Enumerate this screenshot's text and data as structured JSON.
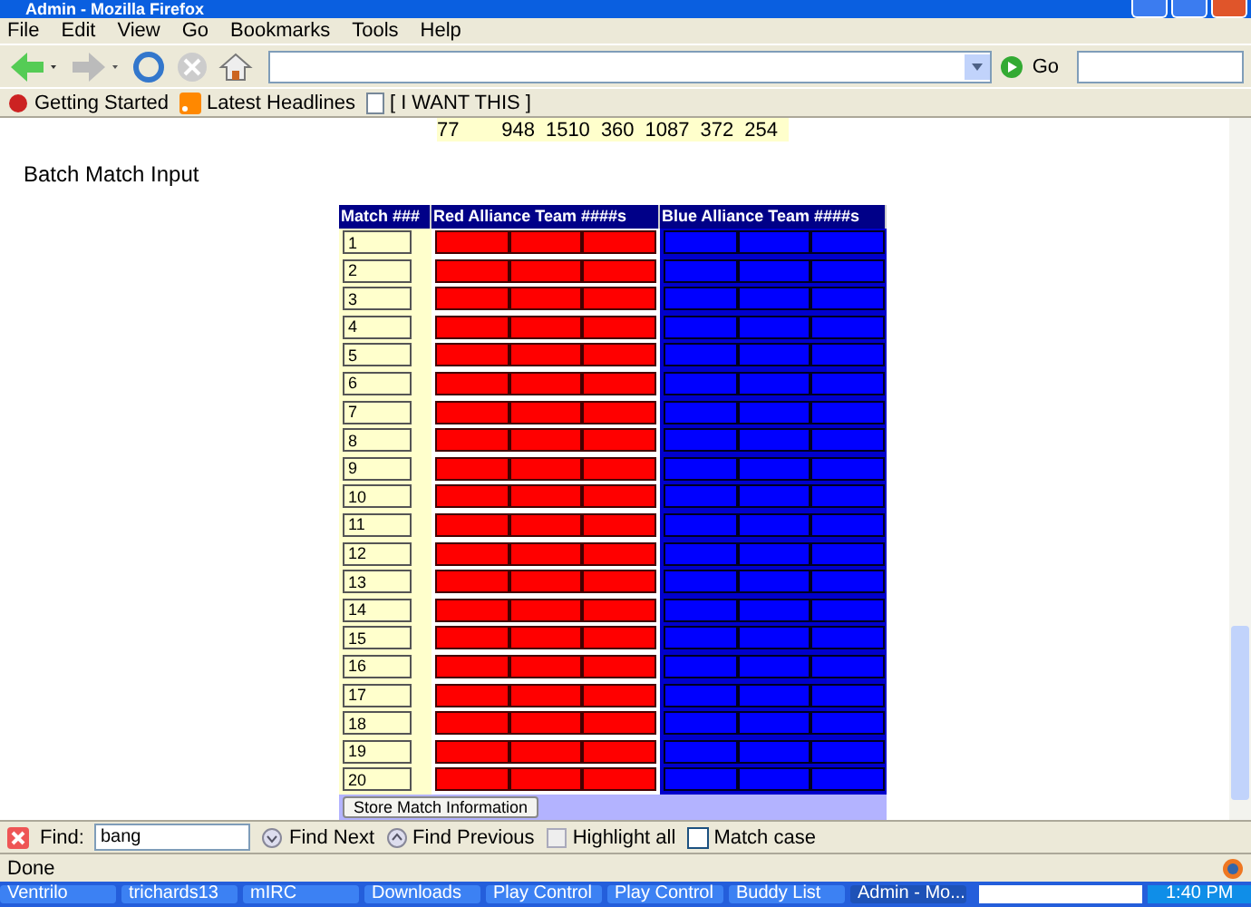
{
  "window": {
    "title": "Admin - Mozilla Firefox"
  },
  "menu": [
    "File",
    "Edit",
    "View",
    "Go",
    "Bookmarks",
    "Tools",
    "Help"
  ],
  "toolbar": {
    "go_label": "Go"
  },
  "bookmarks": [
    {
      "kind": "site",
      "label": "Getting Started"
    },
    {
      "kind": "feed",
      "label": "Latest Headlines"
    },
    {
      "kind": "page",
      "label": "[ I WANT THIS ]"
    }
  ],
  "top_row": [
    "77",
    "948",
    "1510",
    "360",
    "1087",
    "372",
    "254"
  ],
  "page": {
    "heading": "Batch Match Input",
    "columns": [
      "Match ###",
      "Red Alliance Team ####s",
      "Blue Alliance Team ####s"
    ],
    "matches": [
      "1",
      "2",
      "3",
      "4",
      "5",
      "6",
      "7",
      "8",
      "9",
      "10",
      "11",
      "12",
      "13",
      "14",
      "15",
      "16",
      "17",
      "18",
      "19",
      "20"
    ],
    "submit": "Store Match Information"
  },
  "find_bar": {
    "label": "Find:",
    "value": "bang",
    "next": "Find Next",
    "previous": "Find Previous",
    "highlight": "Highlight all",
    "match_case": {
      "label": "Match case",
      "checked": false
    }
  },
  "status_bar": {
    "text": "Done"
  },
  "taskbar": {
    "items": [
      {
        "label": "Ventrilo",
        "selected": false
      },
      {
        "label": "trichards13",
        "selected": false
      },
      {
        "label": "mIRC",
        "selected": false
      },
      {
        "label": "Downloads",
        "selected": false
      },
      {
        "label": "Play Control",
        "selected": false
      },
      {
        "label": "Play Control",
        "selected": false
      },
      {
        "label": "Buddy List",
        "selected": false
      },
      {
        "label": "Admin - Mo...",
        "selected": true
      }
    ],
    "clock": "1:40 PM"
  }
}
